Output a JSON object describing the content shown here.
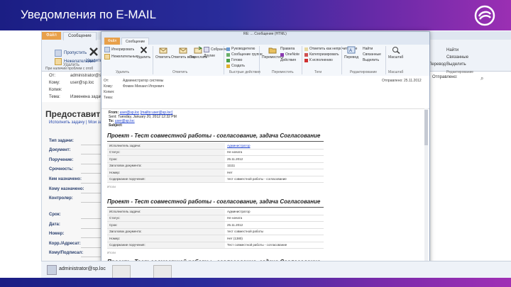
{
  "slide": {
    "title": "Уведомления по E-MAIL"
  },
  "colors": {
    "banner_start": "#1b1e84",
    "banner_end": "#9b2fb3",
    "file_tab": "#e8a04a",
    "link": "#1a3ecf"
  },
  "bg_window": {
    "tabs": [
      "Файл",
      "Сообщение"
    ],
    "buttons": [
      "Пропустить",
      "Нежелательные",
      "Удалить",
      "Ответить",
      "Переслать"
    ],
    "group_delete": "Удалить",
    "fields": {
      "from_label": "От:",
      "from_value": "administrator@sp.loc",
      "to_label": "Кому:",
      "to_value": "user@sp.loc",
      "cc_label": "Копия:",
      "subject_label": "Тема:",
      "subject_value": "Изменена задача: Сог"
    },
    "info_bar": "При наличии проблем с отоб",
    "heading": "Предоставить",
    "actions": "Исполнить задачу | Мои зад",
    "form_labels": [
      "Тип задачи:",
      "Документ:",
      "Поручение:",
      "Срочность:",
      "Кем назначено:",
      "Кому назначено:",
      "Контролер:",
      "Срок:",
      "Дата:",
      "Номер:",
      "Корр./Адресат:",
      "Кому/Подписал:"
    ],
    "right_labels": [
      "Отправлено:",
      "Найти",
      "Связанные",
      "Выделить",
      "Перевод",
      "Редактирование"
    ],
    "people_pane_user": "administrator@sp.loc"
  },
  "email": {
    "window_title": "RE: ... Сообщение (HTML)",
    "tabs": [
      "Файл",
      "Сообщение"
    ],
    "ribbon_buttons": {
      "ignore": "Игнорировать",
      "junk": "Нежелательные",
      "delete": "Удалить",
      "reply": "Ответить",
      "reply_all": "Ответить всем",
      "forward": "Переслать",
      "meeting": "Собрание",
      "more": "Другие",
      "to_manager": "Руководителю",
      "team": "Сообщение группе",
      "done": "Готово",
      "create": "Создать",
      "move": "Переместить",
      "rules": "Правила",
      "onenote": "OneNote",
      "actions": "Действия",
      "mark_unread": "Отметить как непрочитанное",
      "categorize": "Категоризировать",
      "follow_up": "К исполнению",
      "translate": "Перевод",
      "find": "Найти",
      "related": "Связанные",
      "select": "Выделить",
      "zoom": "Масштаб"
    },
    "groups": [
      "Удалить",
      "Ответить",
      "Быстрые действия",
      "Переместить",
      "Теги",
      "Редактирование",
      "Масштаб"
    ],
    "header": {
      "from_label": "От:",
      "from_value": "Администратор системы",
      "to_label": "Кому:",
      "to_value": "Фомин Михаил Игоревич",
      "cc_label": "Копия:",
      "subject_label": "Тема:",
      "subject_value": "",
      "date_value": "Отправлено: 25.11.2012"
    },
    "addr_from_prefix": "From:",
    "addr_from": "user@sp.loc",
    "addr_from_extra": "[mailto:user@sp.loc]",
    "addr_sent": "Sent: Tuesday, January 20, 2012 12:32 PM",
    "addr_to_prefix": "To:",
    "addr_to": "user@sp.loc",
    "addr_subject": "Subject:",
    "blocks": [
      {
        "title": "Проект - Тест совместной работы - согласование, задача Согласование",
        "rows": [
          [
            "Исполнитель задачи:",
            "Администратор"
          ],
          [
            "Статус:",
            "Не начата"
          ],
          [
            "Срок:",
            "25.11.2012"
          ],
          [
            "Заголовок документа:",
            "11111"
          ],
          [
            "Номер:",
            "Нет"
          ],
          [
            "Содержание поручения:",
            "тест совместной работы - согласование"
          ]
        ],
        "comment": "Итоги"
      },
      {
        "title": "Проект - Тест совместной работы - согласование, задача Согласование",
        "rows": [
          [
            "Исполнитель задачи:",
            "Администратор"
          ],
          [
            "Статус:",
            "Не начата"
          ],
          [
            "Срок:",
            "25.11.2012"
          ],
          [
            "Заголовок документа:",
            "тест совместной работы"
          ],
          [
            "Номер:",
            "Нет (1380)"
          ],
          [
            "Содержание поручения:",
            "Тест совместной работы - согласование"
          ]
        ],
        "comment": "Итоги"
      },
      {
        "title": "Проект - Тест совместной работы - согласование, задача Согласование",
        "rows": [
          [
            "Исполнитель задачи:",
            "Администратор"
          ]
        ],
        "comment": ""
      }
    ]
  }
}
